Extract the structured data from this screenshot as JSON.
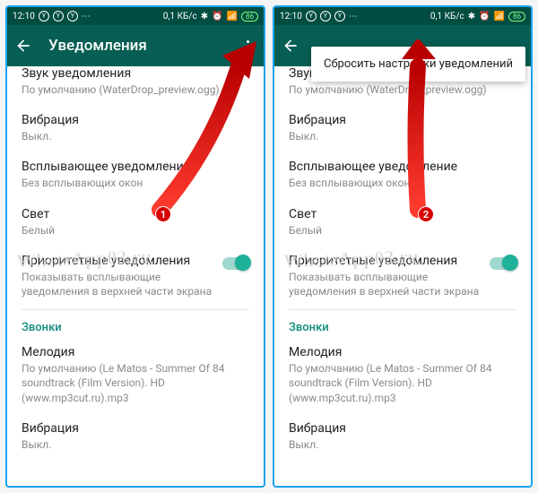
{
  "status": {
    "time": "12:10",
    "net_speed": "0,1 КБ/с"
  },
  "appbar": {
    "title": "Уведомления"
  },
  "popup": {
    "reset": "Сбросить настройки уведомлений"
  },
  "rows": {
    "sound_label": "Звук уведомления",
    "sound_sub": "По умолчанию (WaterDrop_preview.ogg)",
    "vibration_label": "Вибрация",
    "vibration_sub": "Выкл.",
    "popup_label": "Всплывающее уведомление",
    "popup_sub": "Без всплывающих окон",
    "light_label": "Свет",
    "light_sub": "Белый",
    "priority_label": "Приоритетные уведомления",
    "priority_sub": "Показывать всплывающие уведомления в верхней части экрана",
    "section_calls": "Звонки",
    "melody_label": "Мелодия",
    "melody_sub": "По умолчанию (Le Matos - Summer Of 84 soundtrack (Film Version). HD (www.mp3cut.ru).mp3",
    "vib2_label": "Вибрация",
    "vib2_sub": "Выкл."
  },
  "watermark": "WhatsApp03.ru",
  "badges": {
    "one": "1",
    "two": "2"
  }
}
